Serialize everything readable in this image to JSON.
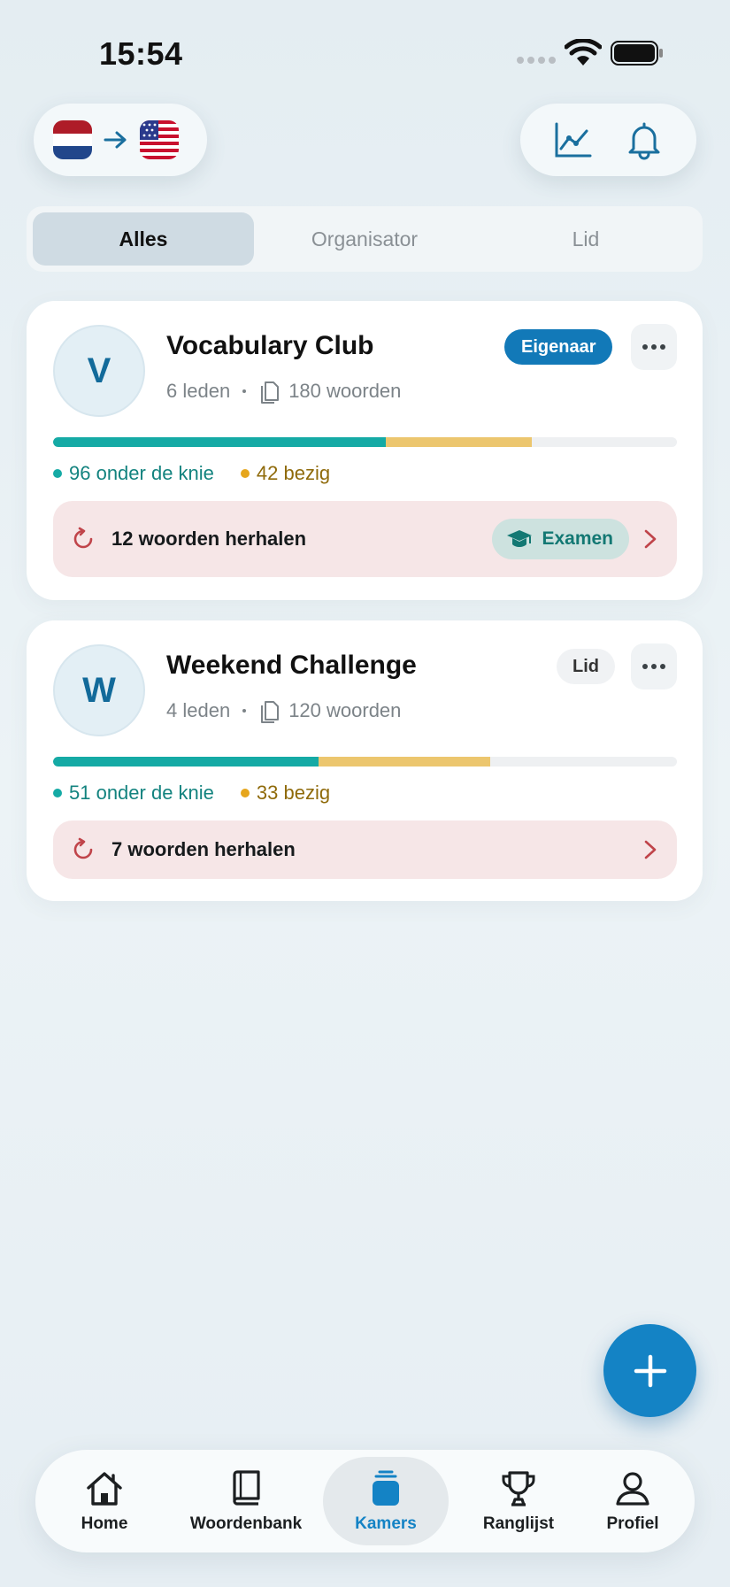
{
  "status_bar": {
    "time": "15:54"
  },
  "top": {
    "from_flag": "netherlands-flag-icon",
    "to_flag": "usa-flag-icon",
    "arrow": "arrow-right-icon",
    "stats_icon": "chart-icon",
    "notifications_icon": "bell-icon"
  },
  "filters": {
    "tabs": [
      {
        "label": "Alles",
        "active": true
      },
      {
        "label": "Organisator",
        "active": false
      },
      {
        "label": "Lid",
        "active": false
      }
    ]
  },
  "rooms": [
    {
      "initial": "V",
      "name": "Vocabulary Club",
      "members": "6 leden",
      "words": "180 woorden",
      "role": "Eigenaar",
      "known_label": "96 onder de knie",
      "busy_label": "42 bezig",
      "known": 96,
      "busy": 42,
      "total": 180,
      "review": "12 woorden herhalen",
      "exam": "Examen"
    },
    {
      "initial": "W",
      "name": "Weekend Challenge",
      "members": "4 leden",
      "words": "120 woorden",
      "role": "Lid",
      "known_label": "51 onder de knie",
      "busy_label": "33 bezig",
      "known": 51,
      "busy": 33,
      "total": 120,
      "review": "7 woorden herhalen"
    }
  ],
  "colors": {
    "accent": "#1483c5",
    "known": "#15aaa5",
    "busy": "#ecc66e",
    "review_bg": "#f6e6e7"
  },
  "fab_icon": "plus-icon",
  "tabbar": {
    "items": [
      {
        "label": "Home",
        "icon": "home-icon"
      },
      {
        "label": "Woordenbank",
        "icon": "book-icon"
      },
      {
        "label": "Kamers",
        "icon": "rooms-icon",
        "active": true
      },
      {
        "label": "Ranglijst",
        "icon": "trophy-icon"
      },
      {
        "label": "Profiel",
        "icon": "person-icon"
      }
    ]
  }
}
